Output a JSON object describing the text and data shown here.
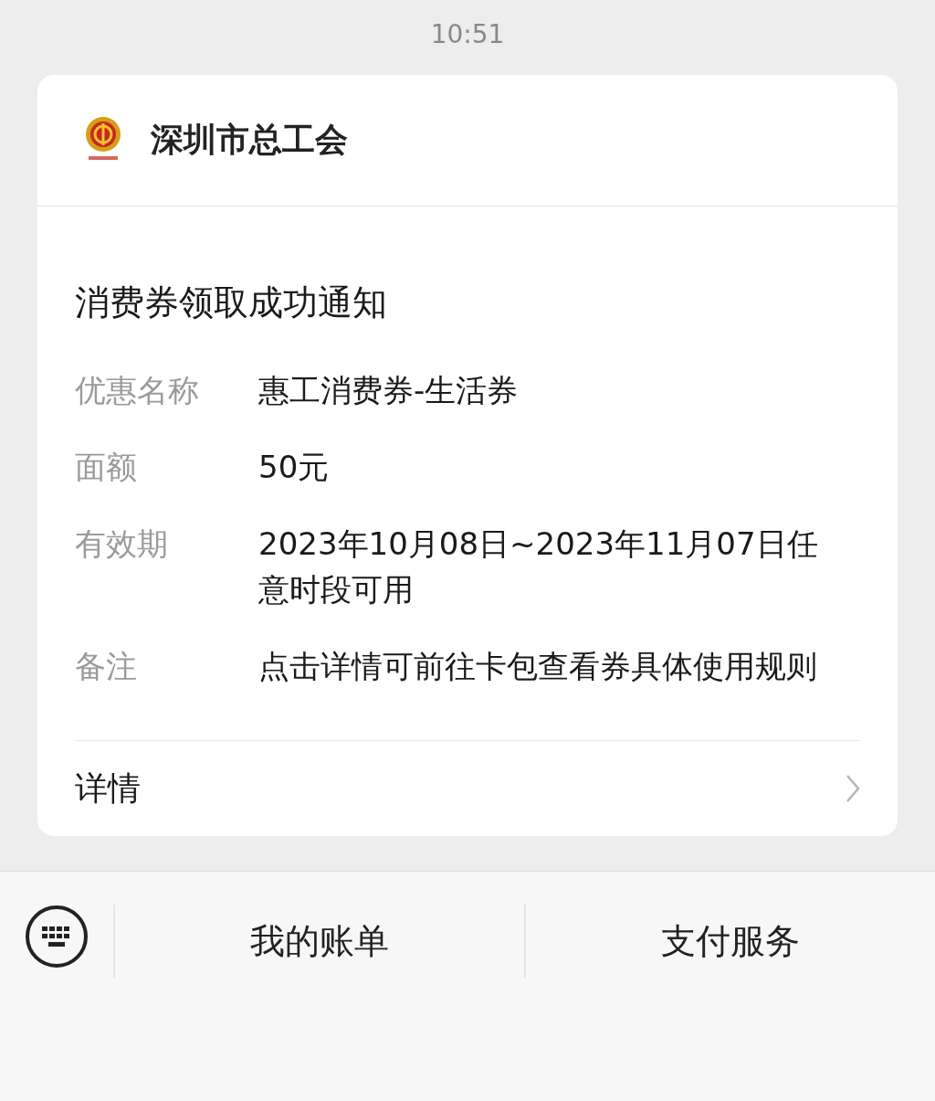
{
  "status_bar": {
    "time": "10:51"
  },
  "card": {
    "account": "深圳市总工会",
    "title": "消费券领取成功通知",
    "fields": [
      {
        "label": "优惠名称",
        "value": "惠工消费券-生活券"
      },
      {
        "label": "面额",
        "value": "50元"
      },
      {
        "label": "有效期",
        "value": "2023年10月08日~2023年11月07日任意时段可用"
      },
      {
        "label": "备注",
        "value": "点击详情可前往卡包查看券具体使用规则"
      }
    ],
    "details_link": "详情"
  },
  "bottom_menu": [
    "我的账单",
    "支付服务"
  ]
}
